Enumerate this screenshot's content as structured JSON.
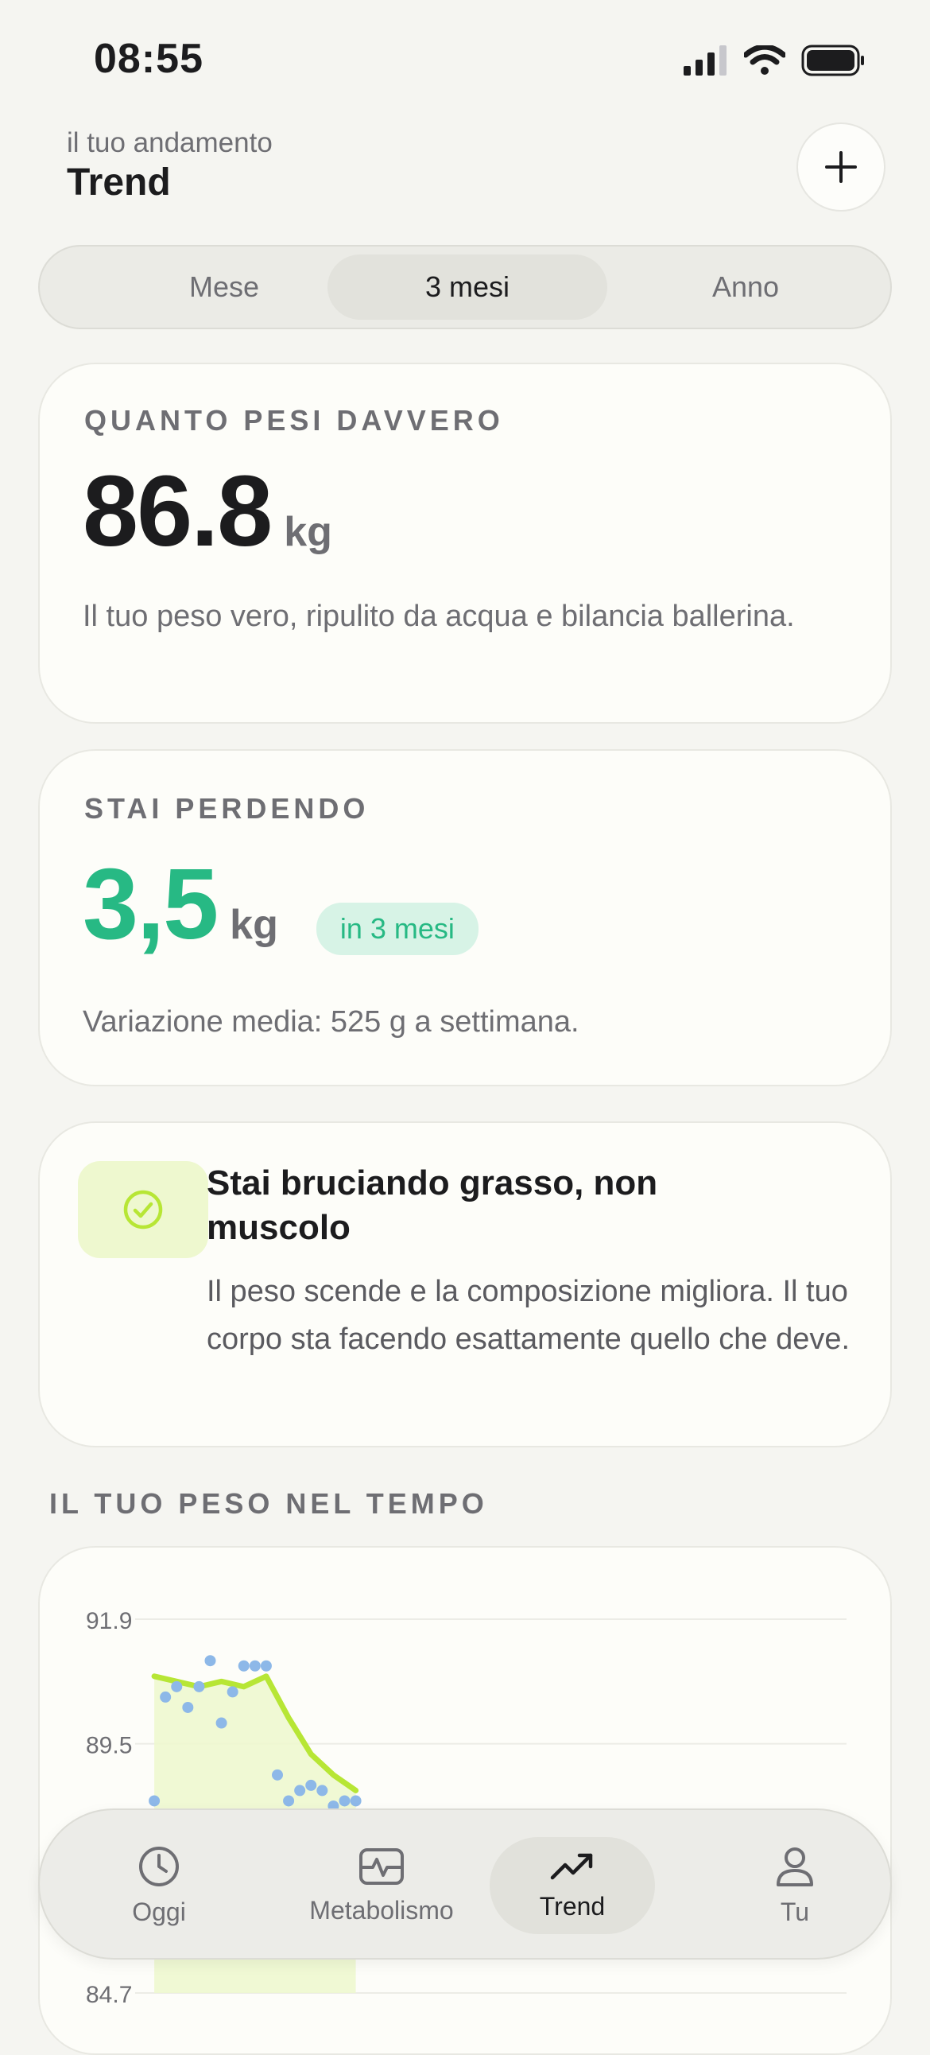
{
  "status": {
    "time": "08:55"
  },
  "header": {
    "subtitle": "il tuo andamento",
    "title": "Trend"
  },
  "segments": [
    "Mese",
    "3 mesi",
    "Anno"
  ],
  "active_segment": "3 mesi",
  "weight_card": {
    "eyebrow": "QUANTO PESI DAVVERO",
    "value": "86.8",
    "unit": "kg",
    "description": "Il tuo peso vero, ripulito da acqua e bilancia ballerina."
  },
  "loss_card": {
    "eyebrow": "STAI PERDENDO",
    "value": "3,5",
    "unit": "kg",
    "badge": "in 3 mesi",
    "note": "Variazione media: 525 g a settimana."
  },
  "insight_card": {
    "title": "Stai bruciando grasso, non muscolo",
    "body": "Il peso scende e la composizione migliora. Il tuo corpo sta facendo esattamente quello che deve.",
    "icon": "check-circle-icon"
  },
  "section_label": "IL TUO PESO NEL TEMPO",
  "chart_data": {
    "type": "scatter",
    "y_ticks": [
      "91.9",
      "89.5",
      "84.7"
    ],
    "ylim": [
      84.7,
      91.9
    ],
    "points": [
      [
        1,
        88.4
      ],
      [
        2,
        90.4
      ],
      [
        3,
        90.6
      ],
      [
        4,
        90.2
      ],
      [
        5,
        90.6
      ],
      [
        6,
        91.1
      ],
      [
        7,
        89.9
      ],
      [
        8,
        90.5
      ],
      [
        9,
        91.0
      ],
      [
        10,
        91.0
      ],
      [
        11,
        91.0
      ],
      [
        12,
        88.9
      ],
      [
        13,
        88.4
      ],
      [
        14,
        88.6
      ],
      [
        15,
        88.7
      ],
      [
        16,
        88.6
      ],
      [
        17,
        88.3
      ],
      [
        18,
        88.4
      ],
      [
        19,
        88.4
      ]
    ],
    "trend": [
      [
        1,
        90.8
      ],
      [
        3,
        90.7
      ],
      [
        5,
        90.6
      ],
      [
        7,
        90.7
      ],
      [
        9,
        90.6
      ],
      [
        11,
        90.8
      ],
      [
        13,
        90.0
      ],
      [
        15,
        89.3
      ],
      [
        17,
        88.9
      ],
      [
        19,
        88.6
      ]
    ],
    "trend_color": "#b7e635",
    "point_color": "#8db8e8"
  },
  "tabbar": [
    {
      "label": "Oggi",
      "icon": "clock-icon"
    },
    {
      "label": "Metabolismo",
      "icon": "pulse-icon"
    },
    {
      "label": "Trend",
      "icon": "trend-icon"
    },
    {
      "label": "Tu",
      "icon": "user-icon"
    }
  ],
  "colors": {
    "accent_green": "#27b984",
    "lime": "#b7e635"
  }
}
